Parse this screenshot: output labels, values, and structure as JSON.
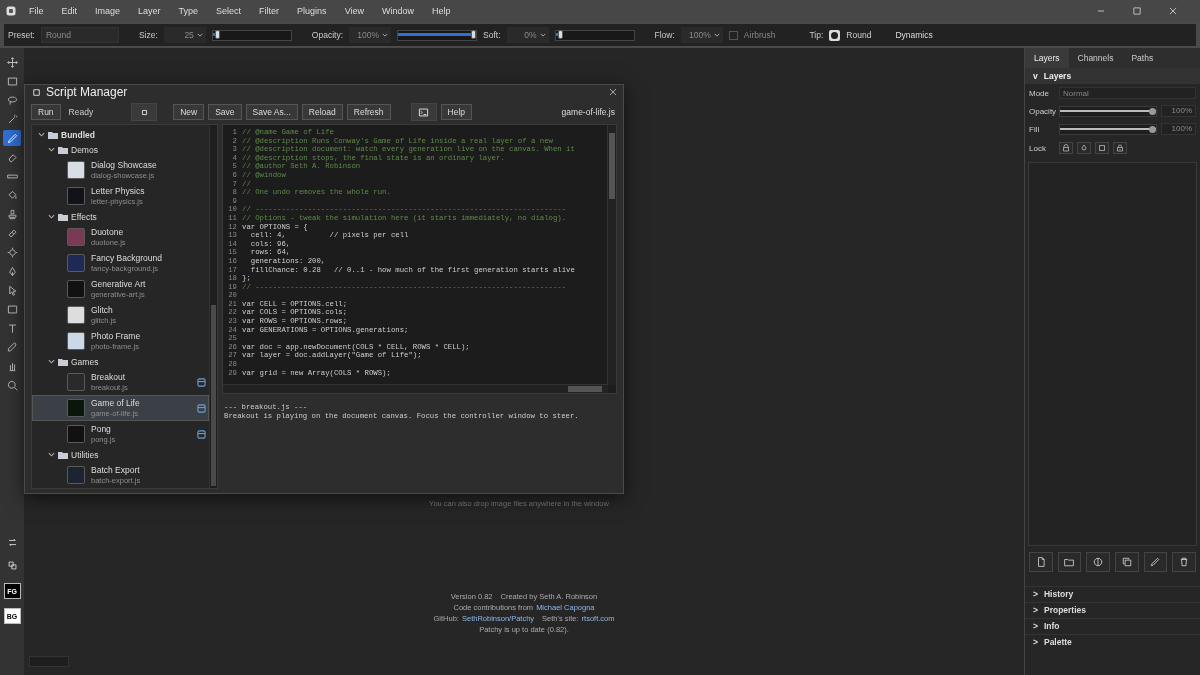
{
  "menu_bar": {
    "items": [
      "File",
      "Edit",
      "Image",
      "Layer",
      "Type",
      "Select",
      "Filter",
      "Plugins",
      "View",
      "Window",
      "Help"
    ]
  },
  "options_bar": {
    "preset": {
      "label": "Preset:",
      "placeholder": "Round"
    },
    "size": {
      "label": "Size:",
      "value": "25",
      "level": 0.03
    },
    "opacity": {
      "label": "Opacity:",
      "value": "100%",
      "level": 1
    },
    "softness": {
      "label": "Soft:",
      "value": "0%",
      "level": 0.03
    },
    "flow": {
      "label": "Flow:",
      "value": "100%"
    },
    "airbrush": {
      "label": "Airbrush",
      "checked": false,
      "disabled": true
    },
    "tip": {
      "label": "Tip:",
      "value": "Round"
    },
    "dynamics": "Dynamics"
  },
  "tools": [
    {
      "selected": false
    },
    {
      "selected": false
    },
    {
      "selected": false
    },
    {
      "selected": false
    },
    {
      "selected": true
    },
    {
      "selected": false
    },
    {
      "selected": false
    },
    {
      "selected": false
    },
    {
      "selected": false
    },
    {
      "selected": false
    },
    {
      "selected": false
    },
    {
      "selected": false
    },
    {
      "selected": false
    },
    {
      "selected": false
    },
    {
      "selected": false
    },
    {
      "selected": false
    },
    {
      "selected": false
    },
    {
      "selected": false
    }
  ],
  "colors": {
    "foreground": "FG",
    "background": "BG"
  },
  "script_manager": {
    "title": "Script Manager",
    "run": "Run",
    "status": "Ready",
    "buttons": [
      "New",
      "Save",
      "Save As...",
      "Reload",
      "Refresh"
    ],
    "help": "Help",
    "filename": "game-of-life.js",
    "tree": [
      {
        "kind": "folder",
        "label": "Bundled",
        "expanded": true,
        "children": [
          {
            "kind": "folder",
            "label": "Demos",
            "expanded": true,
            "children": [
              {
                "kind": "script",
                "title": "Dialog Showcase",
                "file": "dialog-showcase.js",
                "selected": false,
                "has_window": false
              },
              {
                "kind": "script",
                "title": "Letter Physics",
                "file": "letter-physics.js",
                "selected": false,
                "has_window": false
              }
            ]
          },
          {
            "kind": "folder",
            "label": "Effects",
            "expanded": true,
            "children": [
              {
                "kind": "script",
                "title": "Duotone",
                "file": "duotone.js",
                "selected": false,
                "has_window": false
              },
              {
                "kind": "script",
                "title": "Fancy Background",
                "file": "fancy-background.js",
                "selected": false,
                "has_window": false
              },
              {
                "kind": "script",
                "title": "Generative Art",
                "file": "generative-art.js",
                "selected": false,
                "has_window": false
              },
              {
                "kind": "script",
                "title": "Glitch",
                "file": "glitch.js",
                "selected": false,
                "has_window": false
              },
              {
                "kind": "script",
                "title": "Photo Frame",
                "file": "photo-frame.js",
                "selected": false,
                "has_window": false
              }
            ]
          },
          {
            "kind": "folder",
            "label": "Games",
            "expanded": true,
            "children": [
              {
                "kind": "script",
                "title": "Breakout",
                "file": "breakout.js",
                "selected": false,
                "has_window": true
              },
              {
                "kind": "script",
                "title": "Game of Life",
                "file": "game-of-life.js",
                "selected": true,
                "has_window": true
              },
              {
                "kind": "script",
                "title": "Pong",
                "file": "pong.js",
                "selected": false,
                "has_window": true
              }
            ]
          },
          {
            "kind": "folder",
            "label": "Utilities",
            "expanded": true,
            "children": [
              {
                "kind": "script",
                "title": "Batch Export",
                "file": "batch-export.js",
                "selected": false,
                "has_window": false
              }
            ]
          }
        ]
      }
    ],
    "code": [
      {
        "n": "1",
        "text": "// @name Game of Life",
        "kind": "comment"
      },
      {
        "n": "2",
        "text": "// @description Runs Conway's Game of Life inside a real layer of a new",
        "kind": "comment"
      },
      {
        "n": "3",
        "text": "// @description document: watch every generation live on the canvas. When it",
        "kind": "comment"
      },
      {
        "n": "4",
        "text": "// @description stops, the final state is an ordinary layer.",
        "kind": "comment"
      },
      {
        "n": "5",
        "text": "// @author Seth A. Robinson",
        "kind": "comment"
      },
      {
        "n": "6",
        "text": "// @window",
        "kind": "comment"
      },
      {
        "n": "7",
        "text": "//",
        "kind": "comment"
      },
      {
        "n": "8",
        "text": "// One undo removes the whole run.",
        "kind": "comment"
      },
      {
        "n": "9"
      },
      {
        "n": "10",
        "text": "// -----------------------------------------------------------------------",
        "kind": "comment"
      },
      {
        "n": "11",
        "text": "// Options - tweak the simulation here (it starts immediately, no dialog).",
        "kind": "comment"
      },
      {
        "n": "12",
        "text": "var OPTIONS = {",
        "kind": "code"
      },
      {
        "n": "13",
        "text": "  cell: 4,          // pixels per cell",
        "kind": "code"
      },
      {
        "n": "14",
        "text": "  cols: 96,",
        "kind": "code"
      },
      {
        "n": "15",
        "text": "  rows: 64,",
        "kind": "code"
      },
      {
        "n": "16",
        "text": "  generations: 200,",
        "kind": "code"
      },
      {
        "n": "17",
        "text": "  fillChance: 0.28   // 0..1 - how much of the first generation starts alive",
        "kind": "code"
      },
      {
        "n": "18",
        "text": "};",
        "kind": "code"
      },
      {
        "n": "19",
        "text": "// -----------------------------------------------------------------------",
        "kind": "comment"
      },
      {
        "n": "20"
      },
      {
        "n": "21",
        "text": "var CELL = OPTIONS.cell;",
        "kind": "code"
      },
      {
        "n": "22",
        "text": "var COLS = OPTIONS.cols;",
        "kind": "code"
      },
      {
        "n": "23",
        "text": "var ROWS = OPTIONS.rows;",
        "kind": "code"
      },
      {
        "n": "24",
        "text": "var GENERATIONS = OPTIONS.generations;",
        "kind": "code"
      },
      {
        "n": "25"
      },
      {
        "n": "26",
        "text": "var doc = app.newDocument(COLS * CELL, ROWS * CELL);",
        "kind": "code"
      },
      {
        "n": "27",
        "text": "var layer = doc.addLayer(\"Game of Life\");",
        "kind": "code"
      },
      {
        "n": "28"
      },
      {
        "n": "29",
        "text": "var grid = new Array(COLS * ROWS);",
        "kind": "code"
      }
    ],
    "output": [
      "--- breakout.js ---",
      "Breakout is playing on the document canvas. Focus the controller window to steer."
    ]
  },
  "drop_hint": "You can also drop image files anywhere in the window",
  "about": {
    "version": "Version 0.82",
    "created": "Created by Seth A. Robinson",
    "contrib": "Code contributions from",
    "contrib_link": "Michael Capogna",
    "github_label": "GitHub:",
    "github_link": "SethRobinson/Patchy",
    "site_label": "Seth's site:",
    "site_link": "rtsoft.com",
    "update": "Patchy is up to date (0.82)."
  },
  "right_panel": {
    "tabs": [
      {
        "label": "Layers",
        "selected": true
      },
      {
        "label": "Channels",
        "selected": false
      },
      {
        "label": "Paths",
        "selected": false
      }
    ],
    "layers": {
      "toggle": "v",
      "title": "Layers",
      "expanded": true,
      "mode_label": "Mode",
      "mode_placeholder": "Normal",
      "opacity_label": "Opacity",
      "opacity": {
        "level": 1,
        "reading": "100%"
      },
      "fill_label": "Fill",
      "fill": {
        "level": 1,
        "reading": "100%"
      },
      "lock_label": "Lock"
    },
    "sections": [
      {
        "toggle": ">",
        "title": "History"
      },
      {
        "toggle": ">",
        "title": "Properties"
      },
      {
        "toggle": ">",
        "title": "Info"
      },
      {
        "toggle": ">",
        "title": "Palette"
      }
    ]
  }
}
